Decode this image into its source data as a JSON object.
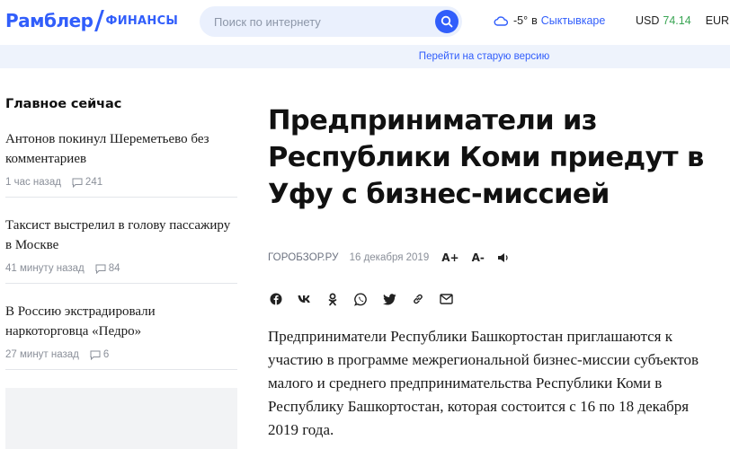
{
  "header": {
    "logo": {
      "brand": "Рамблер",
      "section": "ФИНАНСЫ"
    },
    "search": {
      "placeholder": "Поиск по интернету",
      "value": ""
    },
    "weather": {
      "icon": "cloud-icon",
      "temp": "-5°",
      "prep": "в",
      "city": "Сыктывкаре"
    },
    "currencies": [
      {
        "code": "USD",
        "value": "74.14"
      },
      {
        "code": "EUR",
        "value": ""
      }
    ]
  },
  "old_version_link": "Перейти на старую версию",
  "sidebar": {
    "heading": "Главное сейчас",
    "items": [
      {
        "title": "Антонов покинул Шереметьево без комментариев",
        "time": "1 час назад",
        "comments": "241"
      },
      {
        "title": "Таксист выстрелил в голову пассажиру в Москве",
        "time": "41 минуту назад",
        "comments": "84"
      },
      {
        "title": "В Россию экстрадировали наркоторговца «Педро»",
        "time": "27 минут назад",
        "comments": "6"
      }
    ]
  },
  "article": {
    "title": "Предприниматели из Республики Коми приедут в Уфу с бизнес-миссией",
    "source": "ГОРОБЗОР.РУ",
    "date": "16 декабря 2019",
    "font_increase": "A+",
    "font_decrease": "A-",
    "share_icons": [
      "facebook-icon",
      "vk-icon",
      "odnoklassniki-icon",
      "whatsapp-icon",
      "twitter-icon",
      "copy-link-icon",
      "email-icon"
    ],
    "lead": "Предприниматели Республики Башкортостан приглашаются к участию в программе межрегиональной бизнес-миссии субъектов малого и среднего предпринимательства Республики Коми в Республику Башкортостан, которая состоится с 16 по 18 декабря 2019 года."
  },
  "colors": {
    "accent": "#315efb",
    "positive": "#3aa554",
    "bar": "#eef3fc"
  }
}
